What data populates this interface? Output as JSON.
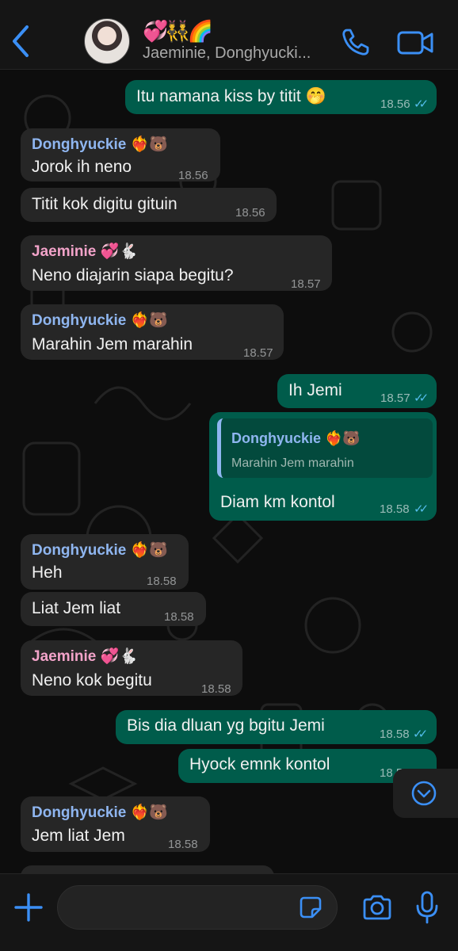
{
  "header": {
    "title_emoji": "💞👯‍♂️🌈",
    "subtitle": "Jaeminie, Donghyucki...",
    "avatar_icon": "group-photo"
  },
  "colors": {
    "accent": "#3b8ff5",
    "outgoing_bubble": "#005c4b",
    "incoming_bubble": "#262626",
    "read_ticks": "#53bdeb",
    "donghyuckie_name": "#8fb6f0",
    "jaeminie_name": "#f2a3c9"
  },
  "messages": [
    {
      "dir": "out",
      "text": "Itu namana kiss by titit 🤭",
      "time": "18.56"
    },
    {
      "dir": "in",
      "sender": "Donghyuckie ❤️‍🔥🐻",
      "text": "Jorok ih neno",
      "time": "18.56"
    },
    {
      "dir": "in",
      "text": "Titit kok digitu gituin",
      "time": "18.56"
    },
    {
      "dir": "in",
      "sender": "Jaeminie 💞🐇",
      "text": "Neno diajarin siapa begitu?",
      "time": "18.57"
    },
    {
      "dir": "in",
      "sender": "Donghyuckie ❤️‍🔥🐻",
      "text": "Marahin Jem marahin",
      "time": "18.57"
    },
    {
      "dir": "out",
      "text": "Ih Jemi",
      "time": "18.57"
    },
    {
      "dir": "out",
      "quote_sender": "Donghyuckie ❤️‍🔥🐻",
      "quote_text": "Marahin Jem marahin",
      "text": "Diam km kontol",
      "time": "18.58"
    },
    {
      "dir": "in",
      "sender": "Donghyuckie ❤️‍🔥🐻",
      "text": "Heh",
      "time": "18.58"
    },
    {
      "dir": "in",
      "text": "Liat Jem liat",
      "time": "18.58"
    },
    {
      "dir": "in",
      "sender": "Jaeminie 💞🐇",
      "text": "Neno kok begitu",
      "time": "18.58"
    },
    {
      "dir": "out",
      "text": "Bis dia dluan yg bgitu Jemi",
      "time": "18.58"
    },
    {
      "dir": "out",
      "text": "Hyock emnk kontol",
      "time": "18.58"
    },
    {
      "dir": "in",
      "sender": "Donghyuckie ❤️‍🔥🐻",
      "text": "Jem liat Jem",
      "time": "18.58"
    }
  ],
  "composer": {
    "placeholder": "",
    "value": ""
  }
}
